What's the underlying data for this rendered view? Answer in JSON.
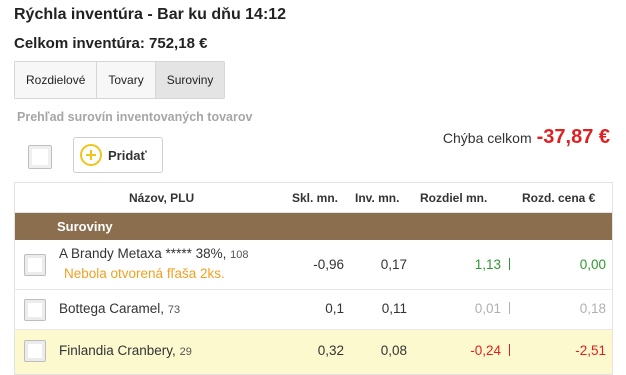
{
  "header": {
    "title": "Rýchla inventúra - Bar ku dňu 14:12",
    "total": "Celkom inventúra: 752,18 €"
  },
  "tabs": [
    {
      "label": "Rozdielové",
      "active": false
    },
    {
      "label": "Tovary",
      "active": false
    },
    {
      "label": "Suroviny",
      "active": true
    }
  ],
  "subtitle": "Prehľad surovín inventovaných tovarov",
  "actions": {
    "add_label": "Pridať"
  },
  "summary": {
    "missing_label": "Chýba celkom",
    "missing_value": "-37,87 €"
  },
  "table": {
    "columns": [
      "Názov, PLU",
      "Skl. mn.",
      "Inv. mn.",
      "Rozdiel mn.",
      "Rozd. cena €"
    ],
    "group": "Suroviny",
    "rows": [
      {
        "name": "A Brandy Metaxa ***** 38%,",
        "plu": "108",
        "note": "Nebola otvorená fľaša 2ks.",
        "stock": "-0,96",
        "inv": "0,17",
        "diff": "1,13",
        "price": "0,00"
      },
      {
        "name": "Bottega Caramel,",
        "plu": "73",
        "note": "",
        "stock": "0,1",
        "inv": "0,11",
        "diff": "0,01",
        "price": "0,18"
      },
      {
        "name": "Finlandia Cranbery,",
        "plu": "29",
        "note": "",
        "stock": "0,32",
        "inv": "0,08",
        "diff": "-0,24",
        "price": "-2,51"
      }
    ]
  },
  "colors": {
    "accent_yellow": "#f0c419",
    "group_brown": "#8b6e4e",
    "negative_red": "#e02020",
    "positive_green": "#2e9a2e",
    "muted_gray": "#b0b0b0",
    "highlight_row": "#fdf9cf",
    "note_orange": "#f0a020"
  },
  "icons": {
    "add": "plus-circle-icon"
  }
}
